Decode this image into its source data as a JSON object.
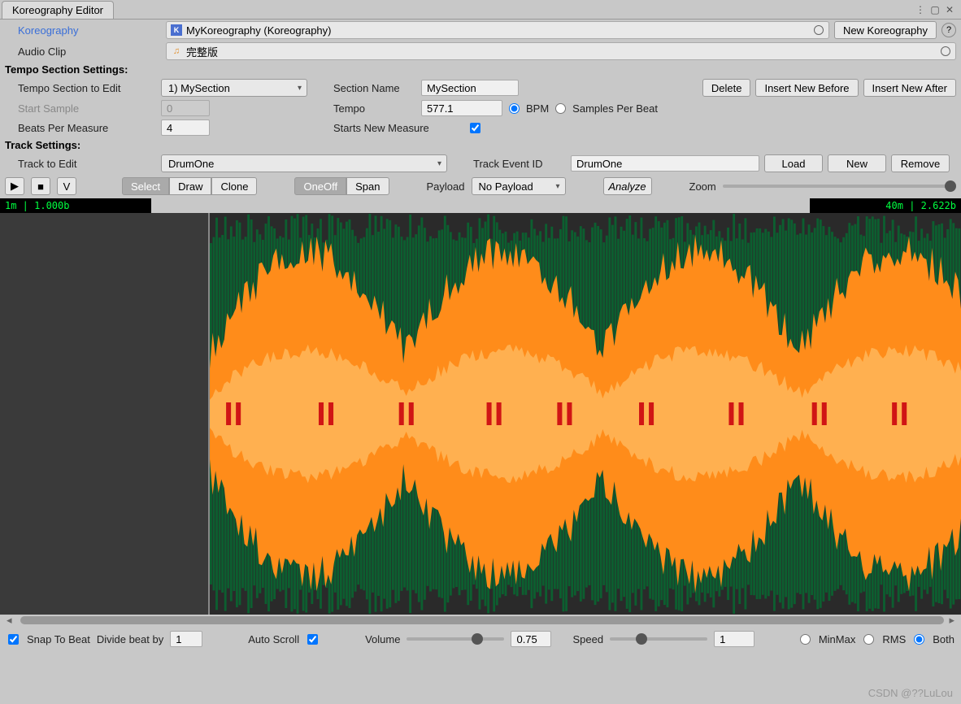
{
  "window": {
    "title": "Koreography Editor"
  },
  "koreography": {
    "label": "Koreography",
    "value": "MyKoreography (Koreography)",
    "newBtn": "New Koreography"
  },
  "audioClip": {
    "label": "Audio Clip",
    "value": "完整版"
  },
  "tempoSection": {
    "heading": "Tempo Section Settings:",
    "toEditLabel": "Tempo Section to Edit",
    "toEditValue": "1) MySection",
    "sectionNameLabel": "Section Name",
    "sectionNameValue": "MySection",
    "deleteBtn": "Delete",
    "insertBeforeBtn": "Insert New Before",
    "insertAfterBtn": "Insert New After",
    "startSampleLabel": "Start Sample",
    "startSampleValue": "0",
    "tempoLabel": "Tempo",
    "tempoValue": "577.1",
    "bpmLabel": "BPM",
    "spbLabel": "Samples Per Beat",
    "beatsPerMeasureLabel": "Beats Per Measure",
    "beatsPerMeasureValue": "4",
    "startsNewMeasureLabel": "Starts New Measure"
  },
  "track": {
    "heading": "Track Settings:",
    "toEditLabel": "Track to Edit",
    "toEditValue": "DrumOne",
    "eventIdLabel": "Track Event ID",
    "eventIdValue": "DrumOne",
    "loadBtn": "Load",
    "newBtn": "New",
    "removeBtn": "Remove"
  },
  "toolbar": {
    "v": "V",
    "select": "Select",
    "draw": "Draw",
    "clone": "Clone",
    "oneoff": "OneOff",
    "span": "Span",
    "payloadLabel": "Payload",
    "payloadValue": "No Payload",
    "analyze": "Analyze",
    "zoomLabel": "Zoom"
  },
  "position": {
    "left": "1m | 1.000b",
    "right": "40m | 2.622b"
  },
  "bottom": {
    "snapLabel": "Snap To Beat",
    "divideLabel": "Divide beat by",
    "divideValue": "1",
    "autoScrollLabel": "Auto Scroll",
    "volumeLabel": "Volume",
    "volumeValue": "0.75",
    "speedLabel": "Speed",
    "speedValue": "1",
    "minmax": "MinMax",
    "rms": "RMS",
    "both": "Both"
  },
  "watermark": "CSDN @??LuLou"
}
